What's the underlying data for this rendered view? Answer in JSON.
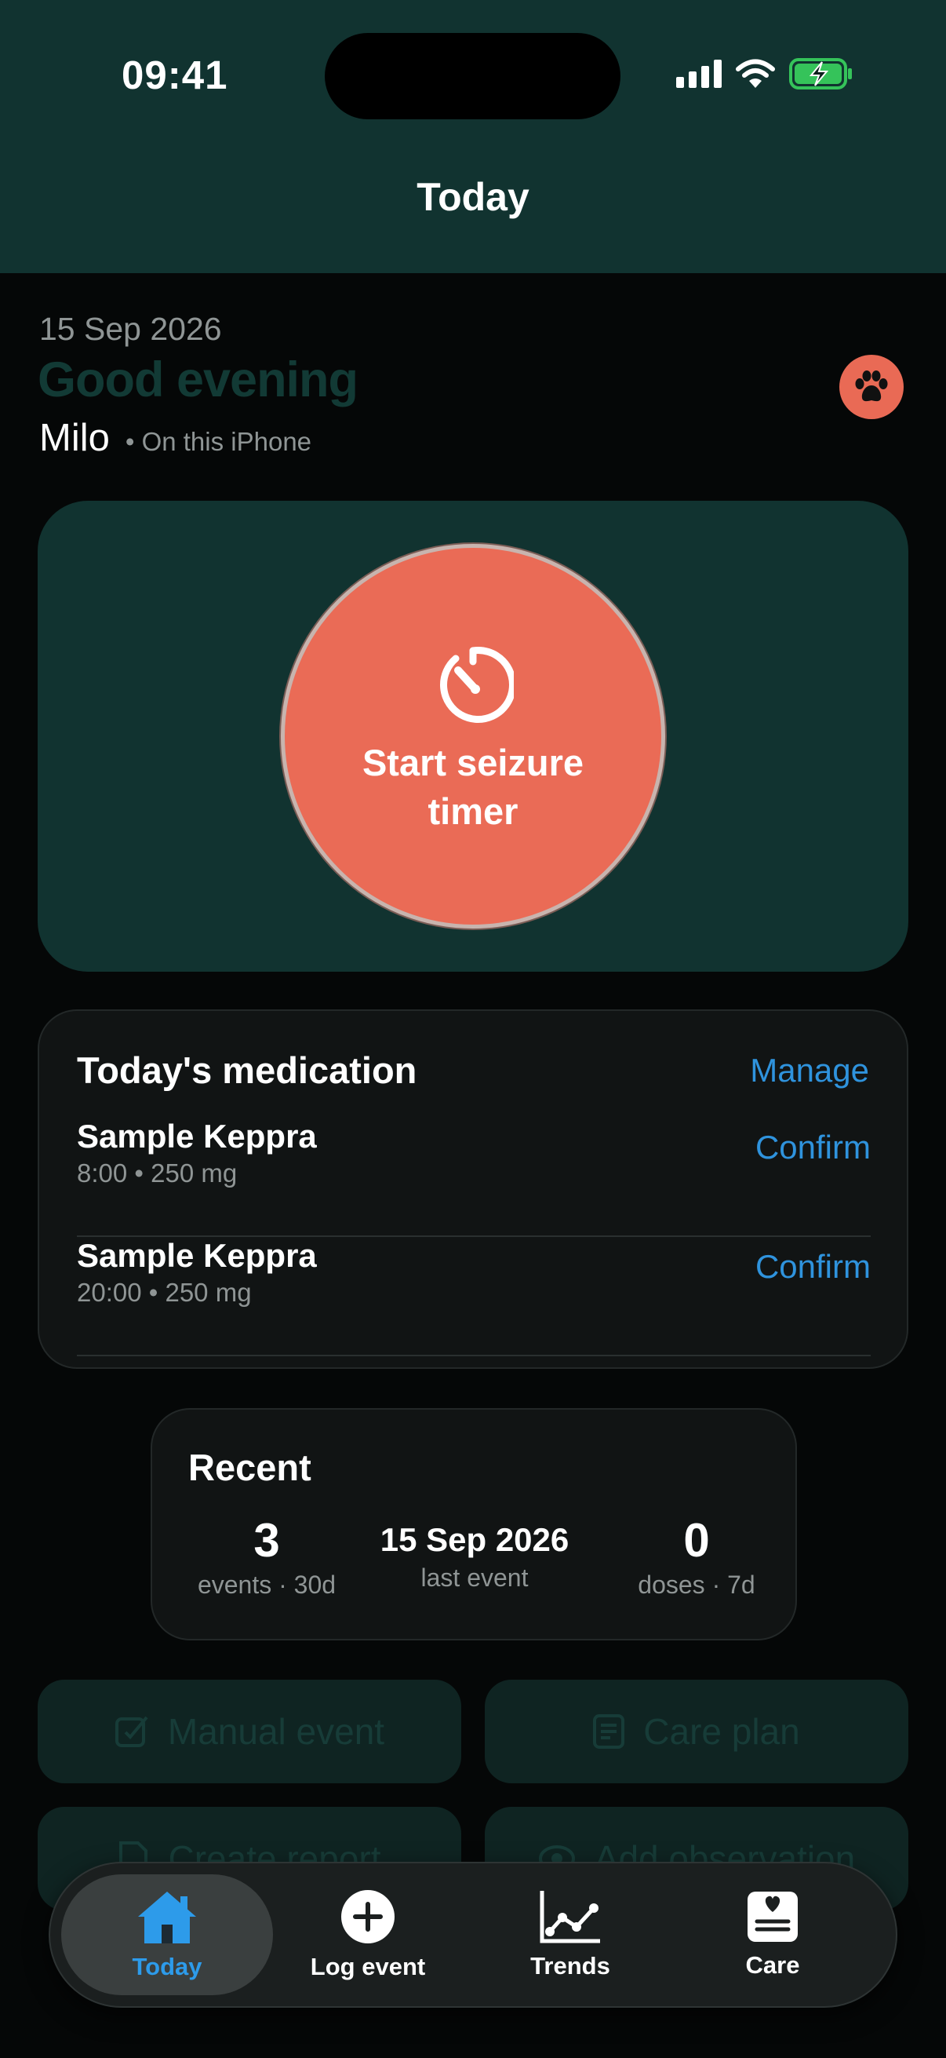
{
  "status_bar": {
    "time": "09:41"
  },
  "header": {
    "title": "Today"
  },
  "greeting": {
    "date": "15 Sep 2026",
    "salutation": "Good evening",
    "pet_name": "Milo",
    "device": "• On this iPhone"
  },
  "timer": {
    "label": "Start seizure timer"
  },
  "medication": {
    "title": "Today's medication",
    "manage_label": "Manage",
    "items": [
      {
        "name": "Sample Keppra",
        "detail": "8:00 • 250 mg",
        "action": "Confirm"
      },
      {
        "name": "Sample Keppra",
        "detail": "20:00 • 250 mg",
        "action": "Confirm"
      }
    ]
  },
  "recent": {
    "title": "Recent",
    "stats": [
      {
        "value": "3",
        "label": "events · 30d"
      },
      {
        "value": "15 Sep 2026",
        "label": "last event"
      },
      {
        "value": "0",
        "label": "doses · 7d"
      }
    ]
  },
  "actions": {
    "manual_event": "Manual event",
    "care_plan": "Care plan",
    "create_report": "Create report",
    "add_observation": "Add observation"
  },
  "tabs": [
    {
      "label": "Today",
      "icon": "house-icon",
      "active": true
    },
    {
      "label": "Log event",
      "icon": "plus-circle-icon",
      "active": false
    },
    {
      "label": "Trends",
      "icon": "chart-line-icon",
      "active": false
    },
    {
      "label": "Care",
      "icon": "care-card-icon",
      "active": false
    }
  ],
  "colors": {
    "header_bg": "#113330",
    "accent_coral": "#ea6b56",
    "link_blue": "#2f93dd",
    "active_tab_blue": "#2d9bea"
  }
}
